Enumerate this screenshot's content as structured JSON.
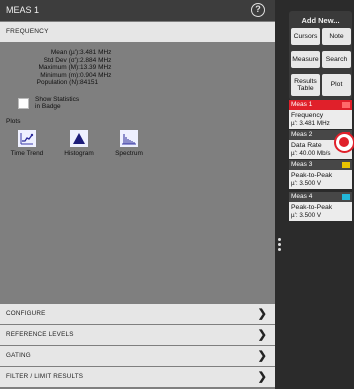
{
  "panel": {
    "title": "MEAS 1",
    "help_icon": "?",
    "section": "FREQUENCY",
    "stats": [
      {
        "label": "Mean (µ'):",
        "value": "3.481 MHz"
      },
      {
        "label": "Std Dev (σ'):",
        "value": "2.884 MHz"
      },
      {
        "label": "Maximum (M):",
        "value": "13.39 MHz"
      },
      {
        "label": "Minimum (m):",
        "value": "0.904 MHz"
      },
      {
        "label": "Population (N):",
        "value": "84151"
      }
    ],
    "show_stats_line1": "Show Statistics",
    "show_stats_line2": "in Badge",
    "plots_label": "Plots",
    "plots": [
      {
        "label": "Time Trend",
        "icon": "time-trend-icon"
      },
      {
        "label": "Histogram",
        "icon": "histogram-icon"
      },
      {
        "label": "Spectrum",
        "icon": "spectrum-icon"
      }
    ],
    "bottom_sections": [
      "CONFIGURE",
      "REFERENCE LEVELS",
      "GATING",
      "FILTER / LIMIT RESULTS"
    ],
    "chevron": "❯"
  },
  "add_new": {
    "title": "Add New...",
    "buttons": {
      "cursors": "Cursors",
      "note": "Note",
      "measure": "Measure",
      "search": "Search",
      "results_table_1": "Results",
      "results_table_2": "Table",
      "plot": "Plot"
    }
  },
  "badges": [
    {
      "header": "Meas 1",
      "name": "Frequency",
      "value": "µ': 3.481 MHz",
      "color": "#e0202a",
      "marker": "#ff6a6a"
    },
    {
      "header": "Meas 2",
      "name": "Data Rate",
      "value": "µ': 40.00 Mb/s",
      "color": "#474747",
      "marker": "#e0202a"
    },
    {
      "header": "Meas 3",
      "name": "Peak-to-Peak",
      "value": "µ': 3.500 V",
      "color": "#474747",
      "marker": "#e8c200"
    },
    {
      "header": "Meas 4",
      "name": "Peak-to-Peak",
      "value": "µ': 3.500 V",
      "color": "#474747",
      "marker": "#22b6d8"
    }
  ]
}
